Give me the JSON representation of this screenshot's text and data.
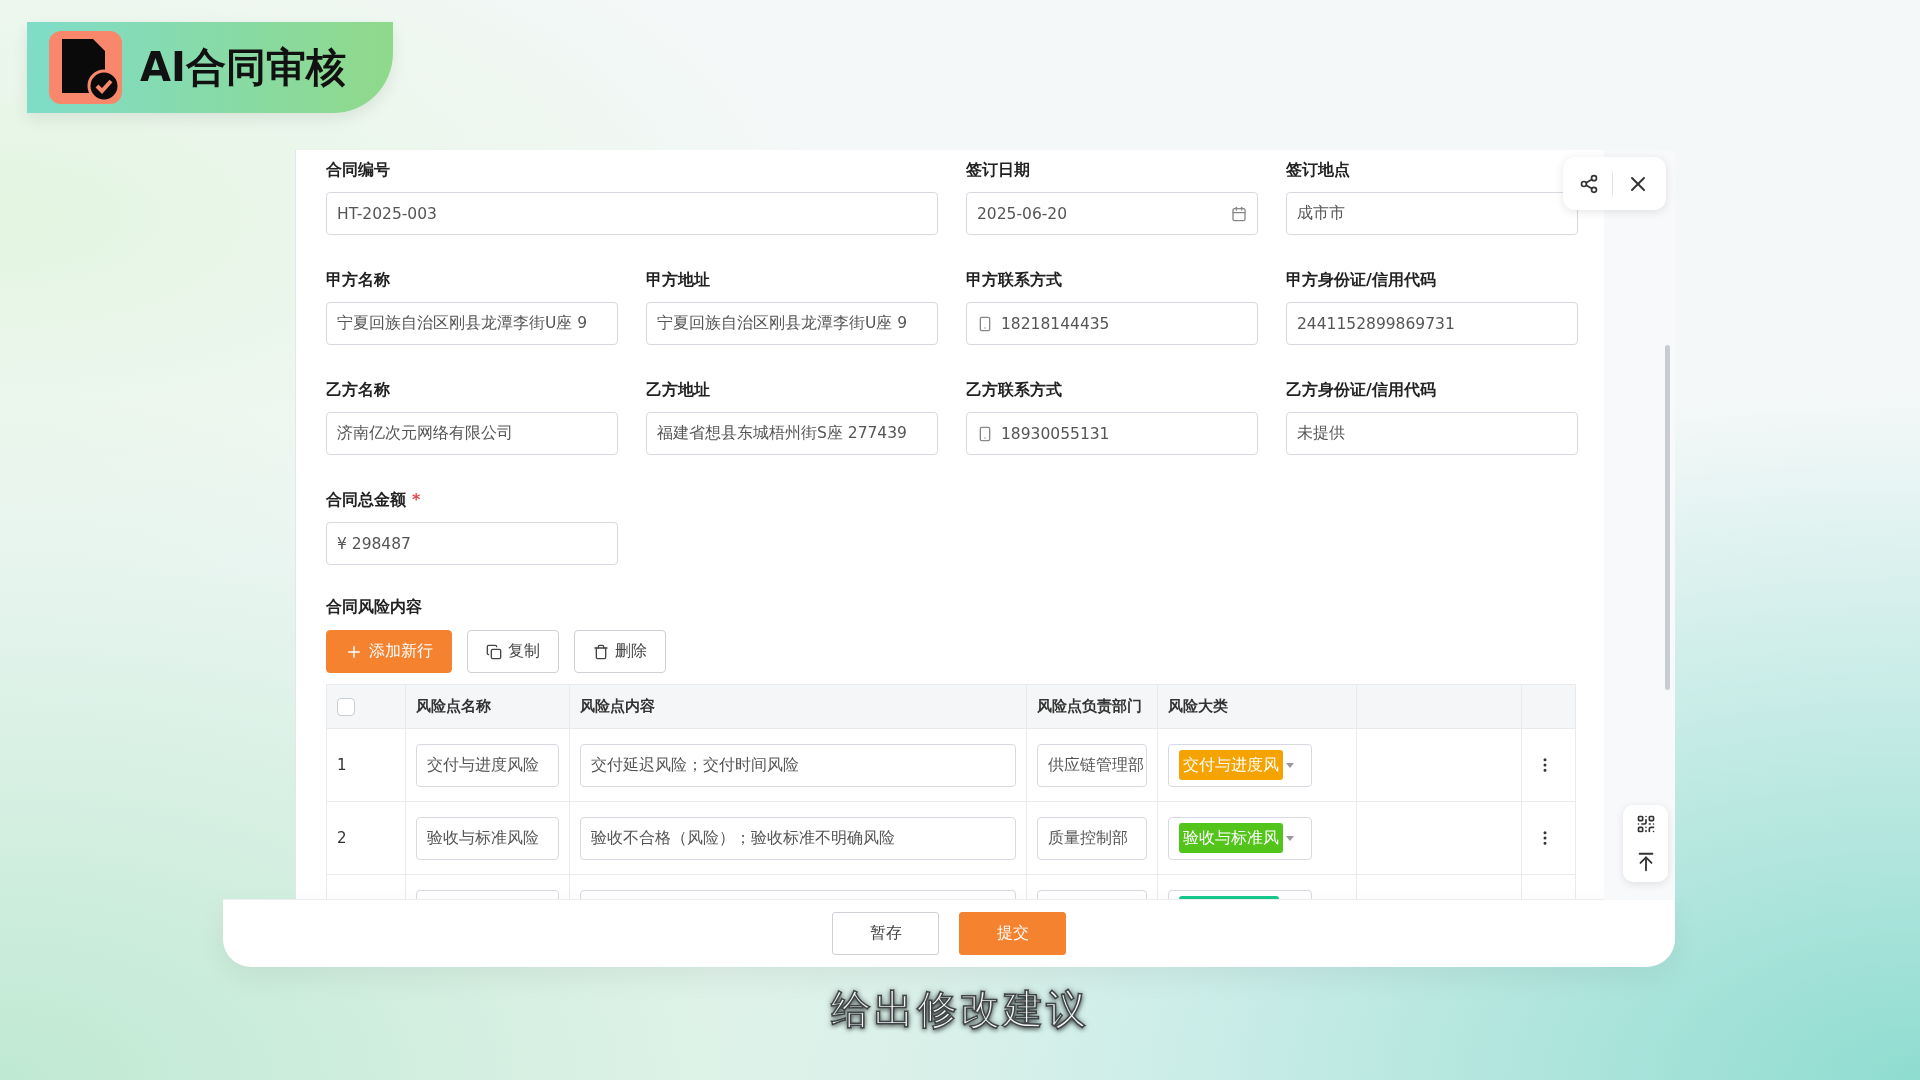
{
  "badge": {
    "title": "AI合同审核"
  },
  "fields": [
    {
      "kind": "wide",
      "label": "合同编号",
      "value": "HT-2025-003"
    },
    {
      "kind": "date",
      "label": "签订日期",
      "value": "2025-06-20"
    },
    {
      "kind": "text",
      "label": "签订地点",
      "value": "成市市"
    },
    {
      "kind": "text",
      "label": "甲方名称",
      "value": "宁夏回族自治区刚县龙潭李街U座 9"
    },
    {
      "kind": "text",
      "label": "甲方地址",
      "value": "宁夏回族自治区刚县龙潭李街U座 9"
    },
    {
      "kind": "phone",
      "label": "甲方联系方式",
      "value": "18218144435"
    },
    {
      "kind": "text",
      "label": "甲方身份证/信用代码",
      "value": "2441152899869731"
    },
    {
      "kind": "text",
      "label": "乙方名称",
      "value": "济南亿次元网络有限公司"
    },
    {
      "kind": "text",
      "label": "乙方地址",
      "value": "福建省想县东城梧州街S座 277439"
    },
    {
      "kind": "phone",
      "label": "乙方联系方式",
      "value": "18930055131"
    },
    {
      "kind": "text",
      "label": "乙方身份证/信用代码",
      "value": "未提供"
    },
    {
      "kind": "text",
      "label": "合同总金额",
      "required_mark": "*",
      "value": "¥ 298487"
    }
  ],
  "risk_section": {
    "title": "合同风险内容",
    "toolbar": [
      {
        "kind": "add",
        "label": "添加新行"
      },
      {
        "kind": "copy",
        "label": "复制"
      },
      {
        "kind": "delete",
        "label": "删除"
      }
    ],
    "table": {
      "select_all": {
        "checked": false
      },
      "columns": [
        "风险点名称",
        "风险点内容",
        "风险点负责部门",
        "风险大类"
      ],
      "rows": [
        {
          "number": "1",
          "name": "交付与进度风险",
          "content": "交付延迟风险；交付时间风险",
          "department": "供应链管理部",
          "category": "交付与进度风",
          "color": "#f5a300"
        },
        {
          "number": "2",
          "name": "验收与标准风险",
          "content": "验收不合格（风险）；验收标准不明确风险",
          "department": "质量控制部",
          "category": "验收与标准风",
          "color": "#52c41a"
        },
        {
          "color": "#16c98d"
        }
      ]
    }
  },
  "footer": {
    "buttons": [
      {
        "kind": "secondary",
        "label": "暂存"
      },
      {
        "kind": "primary",
        "label": "提交"
      }
    ]
  },
  "caption": "给出修改建议"
}
